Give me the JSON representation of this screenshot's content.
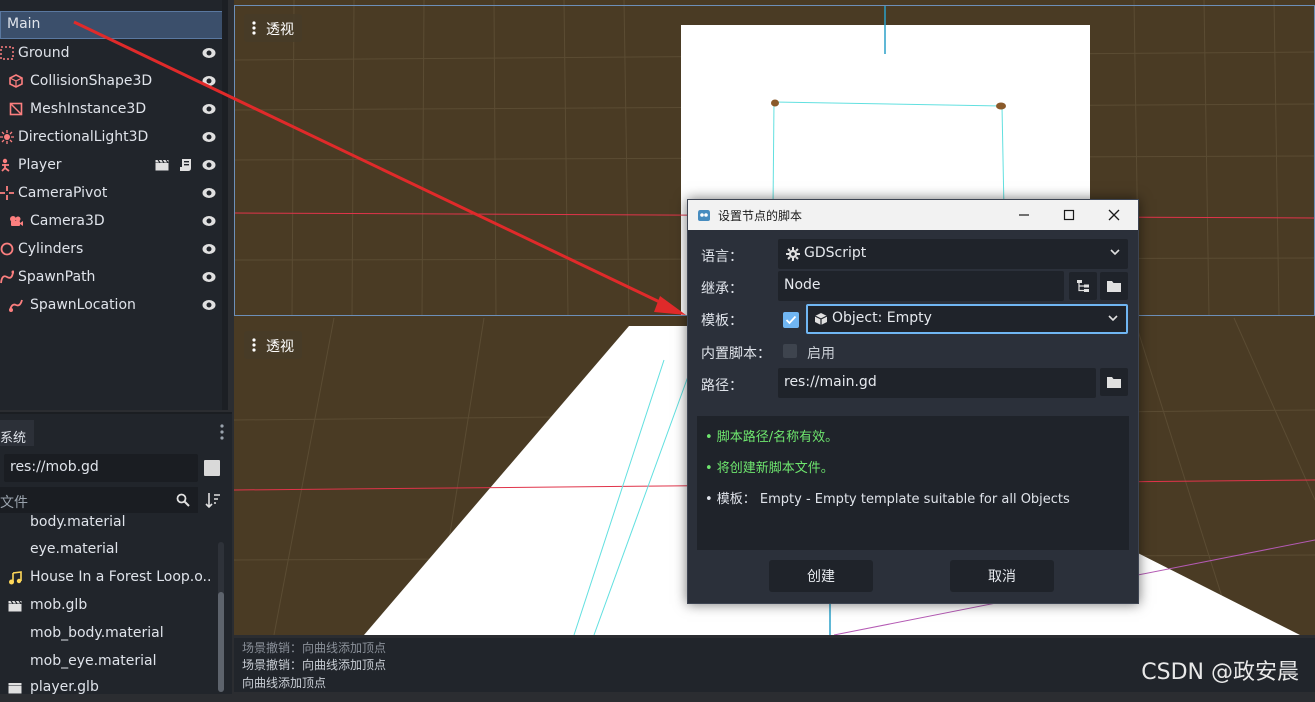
{
  "scene_tree": {
    "root": "Main",
    "nodes": [
      {
        "label": "Ground",
        "icon": "node3d-icon"
      },
      {
        "label": "CollisionShape3D",
        "icon": "collision-shape-icon"
      },
      {
        "label": "MeshInstance3D",
        "icon": "mesh-instance-icon"
      },
      {
        "label": "DirectionalLight3D",
        "icon": "light-icon"
      },
      {
        "label": "Player",
        "icon": "player-icon"
      },
      {
        "label": "CameraPivot",
        "icon": "pivot-icon"
      },
      {
        "label": "Camera3D",
        "icon": "camera-icon"
      },
      {
        "label": "Cylinders",
        "icon": "cylinder-icon"
      },
      {
        "label": "SpawnPath",
        "icon": "path-icon"
      },
      {
        "label": "SpawnLocation",
        "icon": "path-follow-icon"
      }
    ]
  },
  "filesystem": {
    "tab": "系统",
    "path": "res://mob.gd",
    "filter": "文件",
    "files": [
      {
        "label": "body.material",
        "icon": "material-icon"
      },
      {
        "label": "eye.material",
        "icon": "material-icon"
      },
      {
        "label": "House In a Forest Loop.o...",
        "icon": "audio-icon"
      },
      {
        "label": "mob.glb",
        "icon": "scene-icon"
      },
      {
        "label": "mob_body.material",
        "icon": "material-icon"
      },
      {
        "label": "mob_eye.material",
        "icon": "material-icon"
      },
      {
        "label": "player.glb",
        "icon": "scene-icon"
      }
    ]
  },
  "viewport": {
    "top_menu": "透视",
    "bottom_menu": "透视"
  },
  "log": {
    "lines": [
      "场景撤销：向曲线添加顶点",
      "场景撤销：向曲线添加顶点",
      "向曲线添加顶点"
    ]
  },
  "watermark": "CSDN @政安晨",
  "dialog": {
    "title": "设置节点的脚本",
    "language_label": "语言：",
    "language_value": "GDScript",
    "inherits_label": "继承：",
    "inherits_value": "Node",
    "template_label": "模板：",
    "template_value": "Object: Empty",
    "template_checked": true,
    "builtin_label": "内置脚本：",
    "builtin_option": "启用",
    "builtin_checked": false,
    "path_label": "路径：",
    "path_value": "res://main.gd",
    "messages": [
      {
        "text": "• 脚本路径/名称有效。",
        "color": "#6ee66e"
      },
      {
        "text": "• 将创建新脚本文件。",
        "color": "#6ee66e"
      },
      {
        "text": "• 模板： Empty - Empty template suitable for all Objects",
        "color": "#dfe3ea"
      }
    ],
    "create_button": "创建",
    "cancel_button": "取消"
  }
}
